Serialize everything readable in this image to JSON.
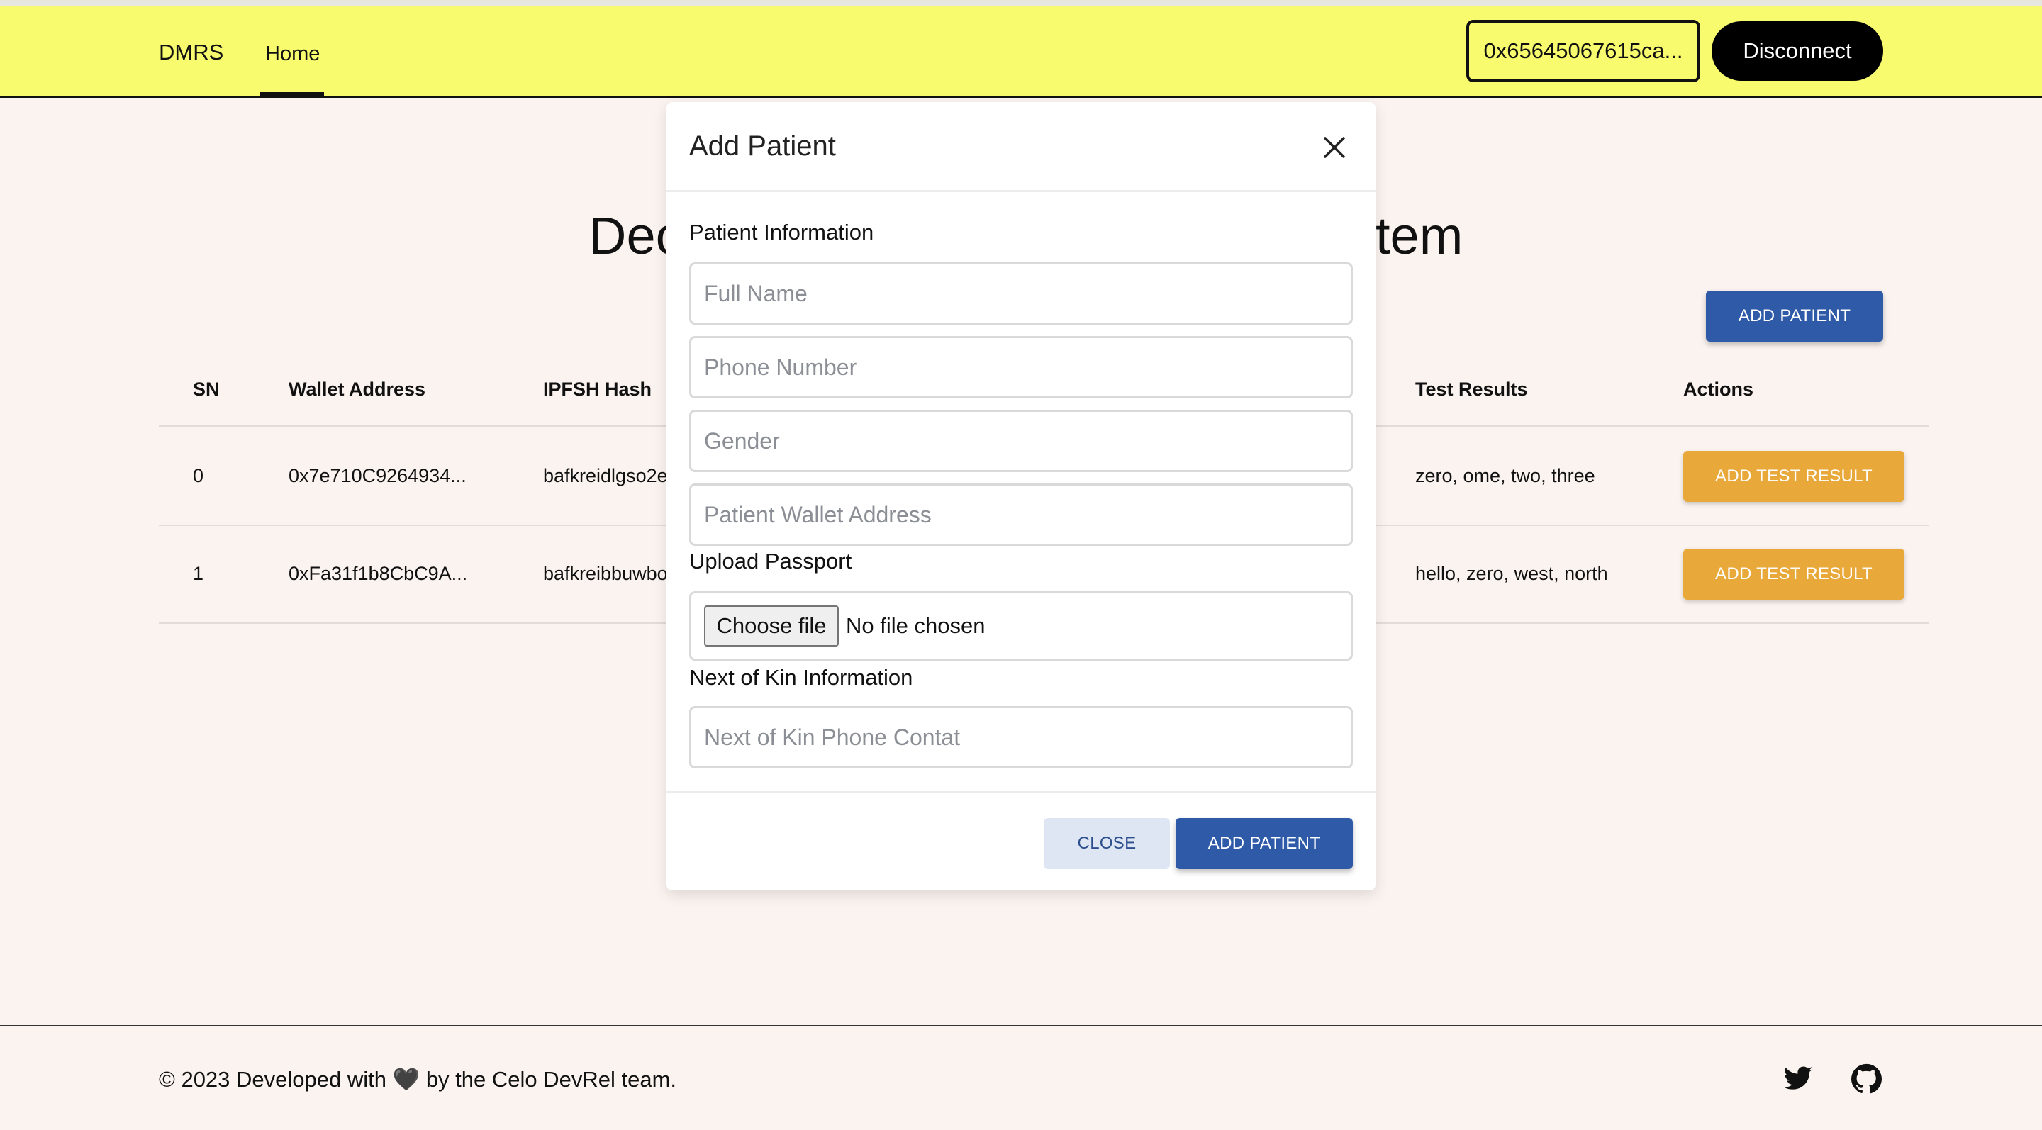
{
  "header": {
    "brand": "DMRS",
    "nav_home": "Home",
    "wallet": "0x65645067615ca...",
    "disconnect": "Disconnect"
  },
  "main": {
    "title_left": "Dec",
    "title_right": "tem",
    "add_patient_label": "ADD PATIENT"
  },
  "table": {
    "columns": {
      "sn": "SN",
      "wallet": "Wallet Address",
      "ipfs": "IPFSH Hash",
      "test_results": "Test Results",
      "actions": "Actions"
    },
    "rows": [
      {
        "sn": "0",
        "wallet": "0x7e710C9264934...",
        "ipfs": "bafkreidlgso2e",
        "test_results": "zero, ome, two, three",
        "action": "ADD TEST RESULT"
      },
      {
        "sn": "1",
        "wallet": "0xFa31f1b8CbC9A...",
        "ipfs": "bafkreibbuwbo",
        "test_results": "hello, zero, west, north",
        "action": "ADD TEST RESULT"
      }
    ]
  },
  "modal": {
    "title": "Add Patient",
    "patient_info_label": "Patient Information",
    "full_name_placeholder": "Full Name",
    "phone_placeholder": "Phone Number",
    "gender_placeholder": "Gender",
    "wallet_placeholder": "Patient Wallet Address",
    "upload_passport_label": "Upload Passport",
    "choose_file": "Choose file",
    "no_file": "No file chosen",
    "kin_info_label": "Next of Kin Information",
    "kin_phone_placeholder": "Next of Kin Phone Contat",
    "close_button": "CLOSE",
    "add_button": "ADD PATIENT"
  },
  "footer": {
    "text": "© 2023 Developed with 🖤 by the Celo DevRel team."
  },
  "colors": {
    "header_bg": "#f8fb6e",
    "primary": "#2f5aa8",
    "accent": "#e9a93a",
    "page_bg": "#fbf3ef"
  },
  "icons": [
    "close-icon",
    "twitter-icon",
    "github-icon"
  ]
}
